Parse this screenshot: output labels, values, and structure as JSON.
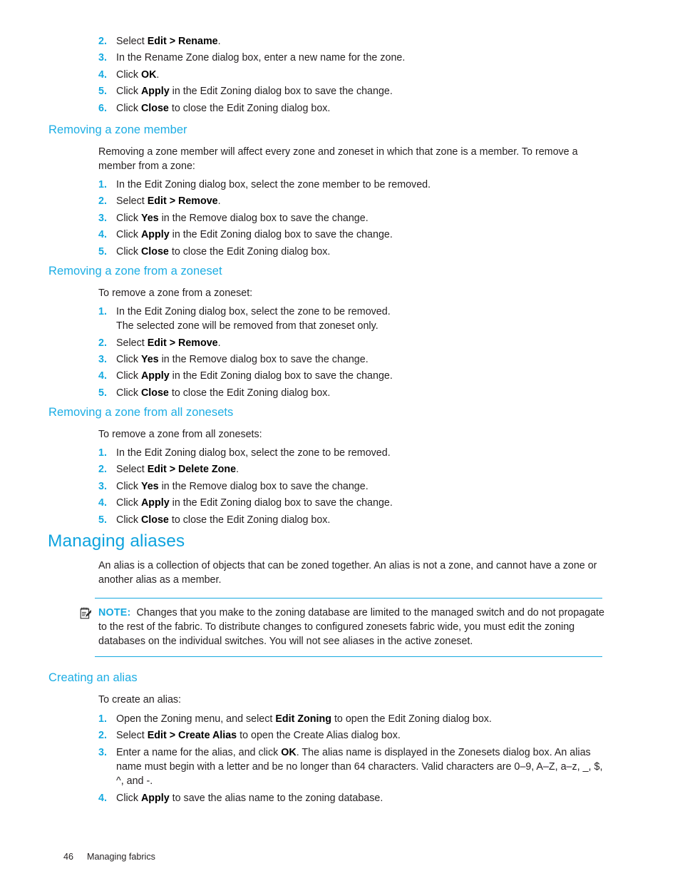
{
  "colors": {
    "heading_h1": "#0fa3de",
    "heading_h2": "#1cade4",
    "list_number": "#14a9e0",
    "rule": "#18a9e0",
    "body_text": "#231f20"
  },
  "sections": {
    "top_list": {
      "steps": [
        {
          "num": "2.",
          "parts": [
            {
              "t": "Select "
            },
            {
              "t": "Edit > Rename",
              "b": true
            },
            {
              "t": "."
            }
          ]
        },
        {
          "num": "3.",
          "parts": [
            {
              "t": "In the Rename Zone dialog box, enter a new name for the zone."
            }
          ]
        },
        {
          "num": "4.",
          "parts": [
            {
              "t": "Click "
            },
            {
              "t": "OK",
              "b": true
            },
            {
              "t": "."
            }
          ]
        },
        {
          "num": "5.",
          "parts": [
            {
              "t": "Click "
            },
            {
              "t": "Apply",
              "b": true
            },
            {
              "t": " in the Edit Zoning dialog box to save the change."
            }
          ]
        },
        {
          "num": "6.",
          "parts": [
            {
              "t": "Click "
            },
            {
              "t": "Close",
              "b": true
            },
            {
              "t": " to close the Edit Zoning dialog box."
            }
          ]
        }
      ]
    },
    "removing_zone_member": {
      "heading": "Removing a zone member",
      "intro": "Removing a zone member will affect every zone and zoneset in which that zone is a member. To remove a member from a zone:",
      "steps": [
        {
          "num": "1.",
          "parts": [
            {
              "t": "In the Edit Zoning dialog box, select the zone member to be removed."
            }
          ]
        },
        {
          "num": "2.",
          "parts": [
            {
              "t": "Select "
            },
            {
              "t": "Edit > Remove",
              "b": true
            },
            {
              "t": "."
            }
          ]
        },
        {
          "num": "3.",
          "parts": [
            {
              "t": "Click "
            },
            {
              "t": "Yes",
              "b": true
            },
            {
              "t": " in the Remove dialog box to save the change."
            }
          ]
        },
        {
          "num": "4.",
          "parts": [
            {
              "t": "Click "
            },
            {
              "t": "Apply",
              "b": true
            },
            {
              "t": " in the Edit Zoning dialog box to save the change."
            }
          ]
        },
        {
          "num": "5.",
          "parts": [
            {
              "t": "Click "
            },
            {
              "t": "Close",
              "b": true
            },
            {
              "t": " to close the Edit Zoning dialog box."
            }
          ]
        }
      ]
    },
    "removing_zone_from_zoneset": {
      "heading": "Removing a zone from a zoneset",
      "intro": "To remove a zone from a zoneset:",
      "steps": [
        {
          "num": "1.",
          "parts": [
            {
              "t": "In the Edit Zoning dialog box, select the zone to be removed."
            },
            {
              "br": true
            },
            {
              "t": "The selected zone will be removed from that zoneset only."
            }
          ]
        },
        {
          "num": "2.",
          "parts": [
            {
              "t": "Select "
            },
            {
              "t": "Edit > Remove",
              "b": true
            },
            {
              "t": "."
            }
          ]
        },
        {
          "num": "3.",
          "parts": [
            {
              "t": "Click "
            },
            {
              "t": "Yes",
              "b": true
            },
            {
              "t": " in the Remove dialog box to save the change."
            }
          ]
        },
        {
          "num": "4.",
          "parts": [
            {
              "t": "Click "
            },
            {
              "t": "Apply",
              "b": true
            },
            {
              "t": " in the Edit Zoning dialog box to save the change."
            }
          ]
        },
        {
          "num": "5.",
          "parts": [
            {
              "t": "Click "
            },
            {
              "t": "Close",
              "b": true
            },
            {
              "t": " to close the Edit Zoning dialog box."
            }
          ]
        }
      ]
    },
    "removing_zone_from_all_zonesets": {
      "heading": "Removing a zone from all zonesets",
      "intro": "To remove a zone from all zonesets:",
      "steps": [
        {
          "num": "1.",
          "parts": [
            {
              "t": "In the Edit Zoning dialog box, select the zone to be removed."
            }
          ]
        },
        {
          "num": "2.",
          "parts": [
            {
              "t": "Select "
            },
            {
              "t": "Edit > Delete Zone",
              "b": true
            },
            {
              "t": "."
            }
          ]
        },
        {
          "num": "3.",
          "parts": [
            {
              "t": "Click "
            },
            {
              "t": "Yes",
              "b": true
            },
            {
              "t": " in the Remove dialog box to save the change."
            }
          ]
        },
        {
          "num": "4.",
          "parts": [
            {
              "t": "Click "
            },
            {
              "t": "Apply",
              "b": true
            },
            {
              "t": " in the Edit Zoning dialog box to save the change."
            }
          ]
        },
        {
          "num": "5.",
          "parts": [
            {
              "t": "Click "
            },
            {
              "t": "Close",
              "b": true
            },
            {
              "t": " to close the Edit Zoning dialog box."
            }
          ]
        }
      ]
    },
    "managing_aliases": {
      "heading": "Managing aliases",
      "intro": "An alias is a collection of objects that can be zoned together. An alias is not a zone, and cannot have a zone or another alias as a member.",
      "note": {
        "icon": "note-pad-pencil-icon",
        "label": "NOTE:",
        "text": "Changes that you make to the zoning database are limited to the managed switch and do not propagate to the rest of the fabric. To distribute changes to configured zonesets fabric wide, you must edit the zoning databases on the individual switches. You will not see aliases in the active zoneset."
      }
    },
    "creating_an_alias": {
      "heading": "Creating an alias",
      "intro": "To create an alias:",
      "steps": [
        {
          "num": "1.",
          "parts": [
            {
              "t": "Open the Zoning menu, and select "
            },
            {
              "t": "Edit Zoning",
              "b": true
            },
            {
              "t": " to open the Edit Zoning dialog box."
            }
          ]
        },
        {
          "num": "2.",
          "parts": [
            {
              "t": "Select "
            },
            {
              "t": "Edit > Create Alias",
              "b": true
            },
            {
              "t": " to open the Create Alias dialog box."
            }
          ]
        },
        {
          "num": "3.",
          "parts": [
            {
              "t": "Enter a name for the alias, and click "
            },
            {
              "t": "OK",
              "b": true
            },
            {
              "t": ". The alias name is displayed in the Zonesets dialog box. An alias name must begin with a letter and be no longer than 64 characters. Valid characters are 0–9, A–Z, a–z, _, $, ^, and -."
            }
          ]
        },
        {
          "num": "4.",
          "parts": [
            {
              "t": "Click "
            },
            {
              "t": "Apply",
              "b": true
            },
            {
              "t": " to save the alias name to the zoning database."
            }
          ]
        }
      ]
    }
  },
  "footer": {
    "page_number": "46",
    "chapter_title": "Managing fabrics"
  }
}
